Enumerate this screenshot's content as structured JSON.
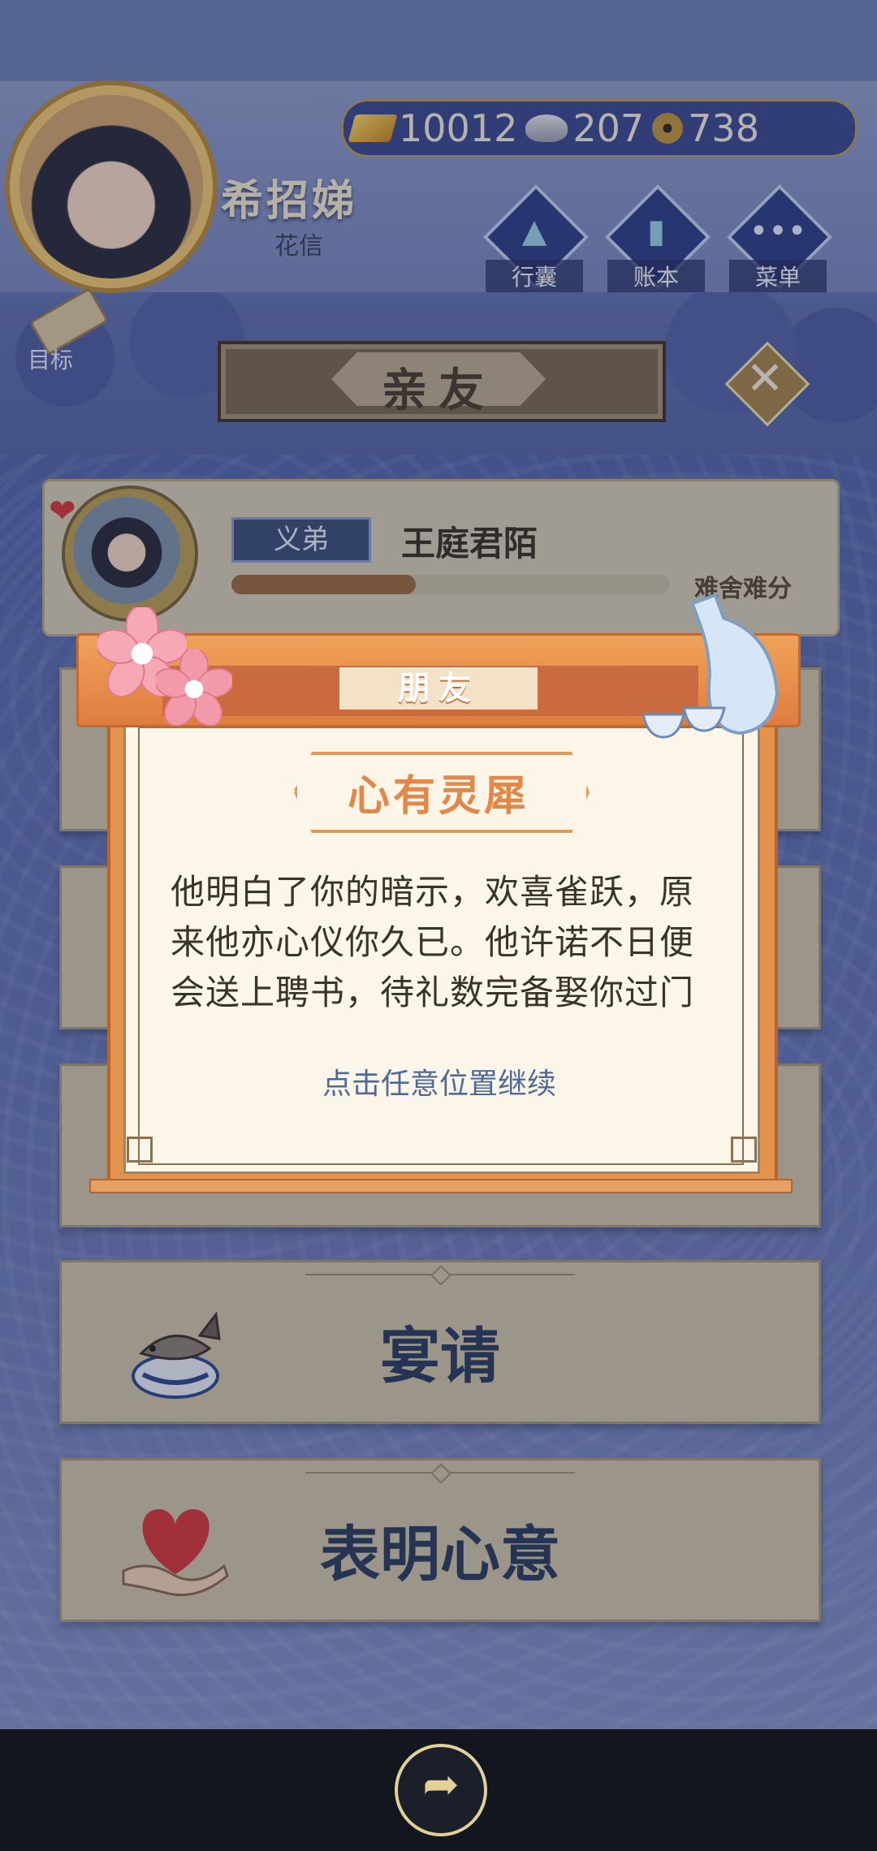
{
  "header": {
    "player_name": "希招娣",
    "player_subtitle": "花信",
    "currency": {
      "gold": "10012",
      "silver": "207",
      "coins": "738",
      "gold_icon": "gold-ingot-icon",
      "silver_icon": "silver-ingot-icon",
      "coin_icon": "copper-coin-icon"
    },
    "buttons": [
      {
        "label": "行囊",
        "icon": "bag-icon",
        "glyph": "▲"
      },
      {
        "label": "账本",
        "icon": "ledger-icon",
        "glyph": "▮"
      },
      {
        "label": "菜单",
        "icon": "menu-dots-icon",
        "glyph": "•••"
      }
    ],
    "target_label": "目标"
  },
  "page": {
    "title": "亲友",
    "close_glyph": "✕"
  },
  "friend": {
    "relation": "义弟",
    "name": "王庭君陌",
    "favor_fraction": 0.42,
    "status": "难舍难分",
    "heart_glyph": "❤"
  },
  "actions": [
    {
      "label": "宴请",
      "icon": "fish-bowl-icon"
    },
    {
      "label": "表明心意",
      "icon": "heart-in-hand-icon"
    }
  ],
  "popup": {
    "tag": "朋友",
    "title": "心有灵犀",
    "body": "他明白了你的暗示，欢喜雀跃，原来他亦心仪你久已。他许诺不日便会送上聘书，待礼数完备娶你过门",
    "hint": "点击任意位置继续"
  },
  "bottom": {
    "share_glyph": "➦"
  },
  "colors": {
    "accent_orange": "#e4934f",
    "card_bg": "#cfc4a8",
    "text_navy": "#2d3d5e"
  }
}
